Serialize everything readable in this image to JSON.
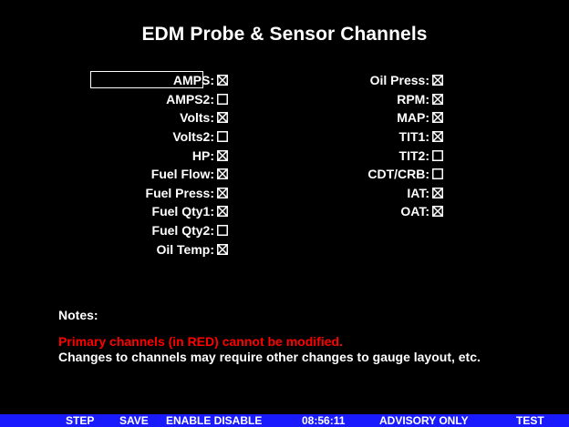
{
  "title": "EDM Probe & Sensor Channels",
  "left_channels": [
    {
      "label": "AMPS:",
      "checked": true
    },
    {
      "label": "AMPS2:",
      "checked": false
    },
    {
      "label": "Volts:",
      "checked": true
    },
    {
      "label": "Volts2:",
      "checked": false
    },
    {
      "label": "HP:",
      "checked": true
    },
    {
      "label": "Fuel Flow:",
      "checked": true
    },
    {
      "label": "Fuel Press:",
      "checked": true
    },
    {
      "label": "Fuel Qty1:",
      "checked": true
    },
    {
      "label": "Fuel Qty2:",
      "checked": false
    },
    {
      "label": "Oil Temp:",
      "checked": true
    }
  ],
  "right_channels": [
    {
      "label": "Oil Press:",
      "checked": true
    },
    {
      "label": "RPM:",
      "checked": true
    },
    {
      "label": "MAP:",
      "checked": true
    },
    {
      "label": "TIT1:",
      "checked": true
    },
    {
      "label": "TIT2:",
      "checked": false
    },
    {
      "label": "CDT/CRB:",
      "checked": false
    },
    {
      "label": "IAT:",
      "checked": true
    },
    {
      "label": "OAT:",
      "checked": true
    }
  ],
  "notes": {
    "heading": "Notes:",
    "primary_warning": "Primary channels (in RED) cannot be modified.",
    "changes_note": "Changes to channels may require other changes to gauge layout, etc."
  },
  "softkeys": {
    "step": "STEP",
    "save": "SAVE",
    "enable_disable": "ENABLE DISABLE",
    "clock": "08:56:11",
    "advisory": "ADVISORY ONLY",
    "test": "TEST"
  },
  "colors": {
    "background": "#000000",
    "text": "#ffffff",
    "warning": "#ff0000",
    "softkey_bar": "#1a1aff"
  }
}
